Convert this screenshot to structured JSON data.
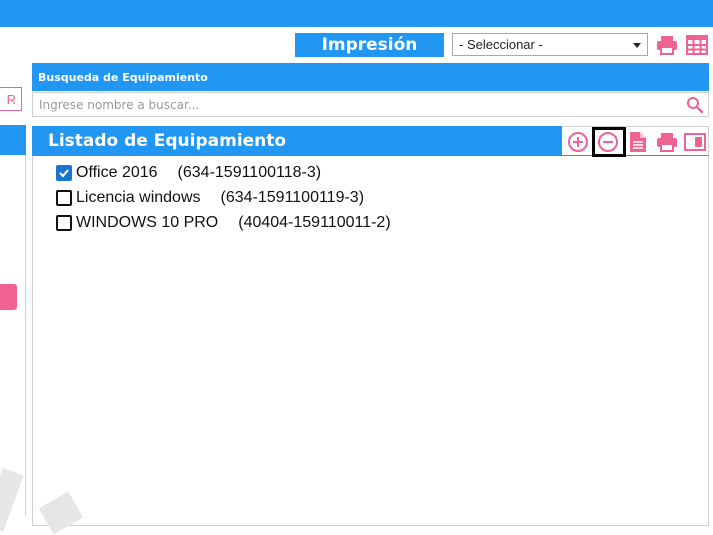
{
  "header": {
    "print_label": "Impresión",
    "select_value": "- Seleccionar -"
  },
  "left": {
    "button_partial": "R"
  },
  "search": {
    "title": "Busqueda de Equipamiento",
    "placeholder": "Ingrese nombre a buscar..."
  },
  "list": {
    "title": "Listado de Equipamiento",
    "items": [
      {
        "name": "Office 2016",
        "code": "(634-1591100118-3)",
        "checked": true
      },
      {
        "name": "Licencia windows",
        "code": "(634-1591100119-3)",
        "checked": false
      },
      {
        "name": "WINDOWS 10 PRO",
        "code": "(40404-159110011-2)",
        "checked": false
      }
    ]
  },
  "colors": {
    "primary": "#2196f3",
    "accent": "#f06292",
    "check": "#1976d2"
  },
  "icons": {
    "print": "printer-icon",
    "table": "table-grid-icon",
    "search": "search-icon",
    "add": "plus-circle-icon",
    "remove": "minus-circle-icon",
    "document": "document-icon",
    "print_list": "printer-icon",
    "window": "window-icon"
  }
}
